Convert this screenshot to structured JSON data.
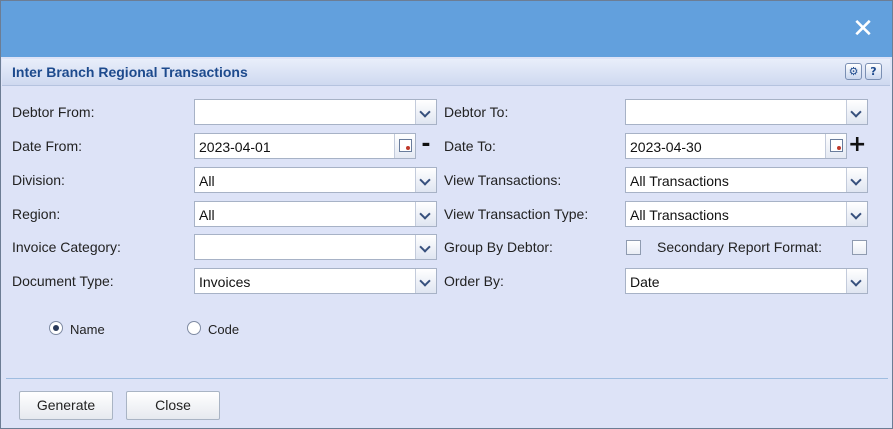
{
  "window": {
    "close_glyph": "✕"
  },
  "panel": {
    "title": "Inter Branch Regional Transactions",
    "config_icon": "gear-icon",
    "help_label": "?"
  },
  "form": {
    "debtor_from": {
      "label": "Debtor From:",
      "value": ""
    },
    "debtor_to": {
      "label": "Debtor To:",
      "value": ""
    },
    "date_from": {
      "label": "Date From:",
      "value": "2023-04-01",
      "stepper": "-"
    },
    "date_to": {
      "label": "Date To:",
      "value": "2023-04-30",
      "stepper": "+"
    },
    "division": {
      "label": "Division:",
      "value": "All"
    },
    "view_transactions": {
      "label": "View Transactions:",
      "value": "All Transactions"
    },
    "region": {
      "label": "Region:",
      "value": "All"
    },
    "view_transaction_type": {
      "label": "View Transaction Type:",
      "value": "All Transactions"
    },
    "invoice_category": {
      "label": "Invoice Category:",
      "value": ""
    },
    "group_by_debtor": {
      "label": "Group By Debtor:",
      "checked": false
    },
    "secondary_report_format": {
      "label": "Secondary Report Format:",
      "checked": false
    },
    "document_type": {
      "label": "Document Type:",
      "value": "Invoices"
    },
    "order_by": {
      "label": "Order By:",
      "value": "Date"
    },
    "sort_radio": {
      "name_label": "Name",
      "code_label": "Code",
      "selected": "Name"
    }
  },
  "buttons": {
    "generate": "Generate",
    "close": "Close"
  }
}
